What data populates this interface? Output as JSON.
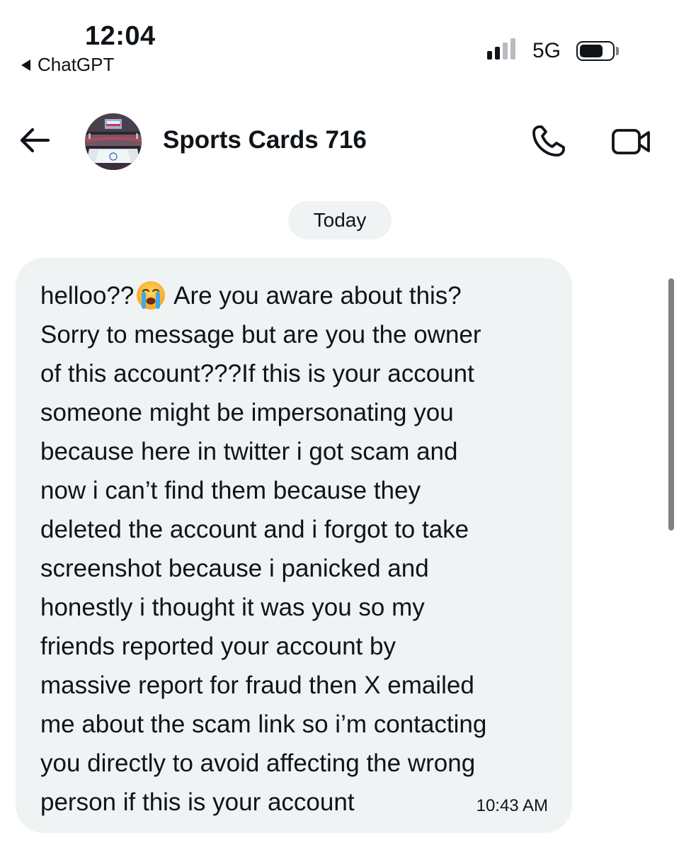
{
  "status_bar": {
    "time": "12:04",
    "back_app": "ChatGPT",
    "network": "5G",
    "signal_bars_active": 2,
    "signal_bars_total": 4,
    "battery_level": 0.75
  },
  "header": {
    "contact_name": "Sports Cards 716",
    "icons": [
      "back-arrow-icon",
      "avatar",
      "phone-icon",
      "video-icon"
    ]
  },
  "conversation": {
    "date_separator": "Today",
    "messages": [
      {
        "text_before_emoji": "helloo??",
        "emoji": "loudly-crying-face",
        "text_after_emoji": " Are you aware about this?\nSorry to message but are you the owner\nof this account???If this is your account\nsomeone might be impersonating you\nbecause here in twitter i got scam and\nnow i can’t find them because they\ndeleted the account and i forgot to take\nscreenshot because i panicked and\nhonestly i thought it was you so my\nfriends reported your account by\nmassive report for fraud then X emailed\nme about the scam link so i’m contacting\nyou directly to avoid affecting the wrong\nperson if this is your account",
        "time": "10:43 AM"
      }
    ]
  },
  "colors": {
    "bubble_bg": "#eff3f4",
    "text": "#0f1419",
    "scrollbar": "#7d8084"
  }
}
